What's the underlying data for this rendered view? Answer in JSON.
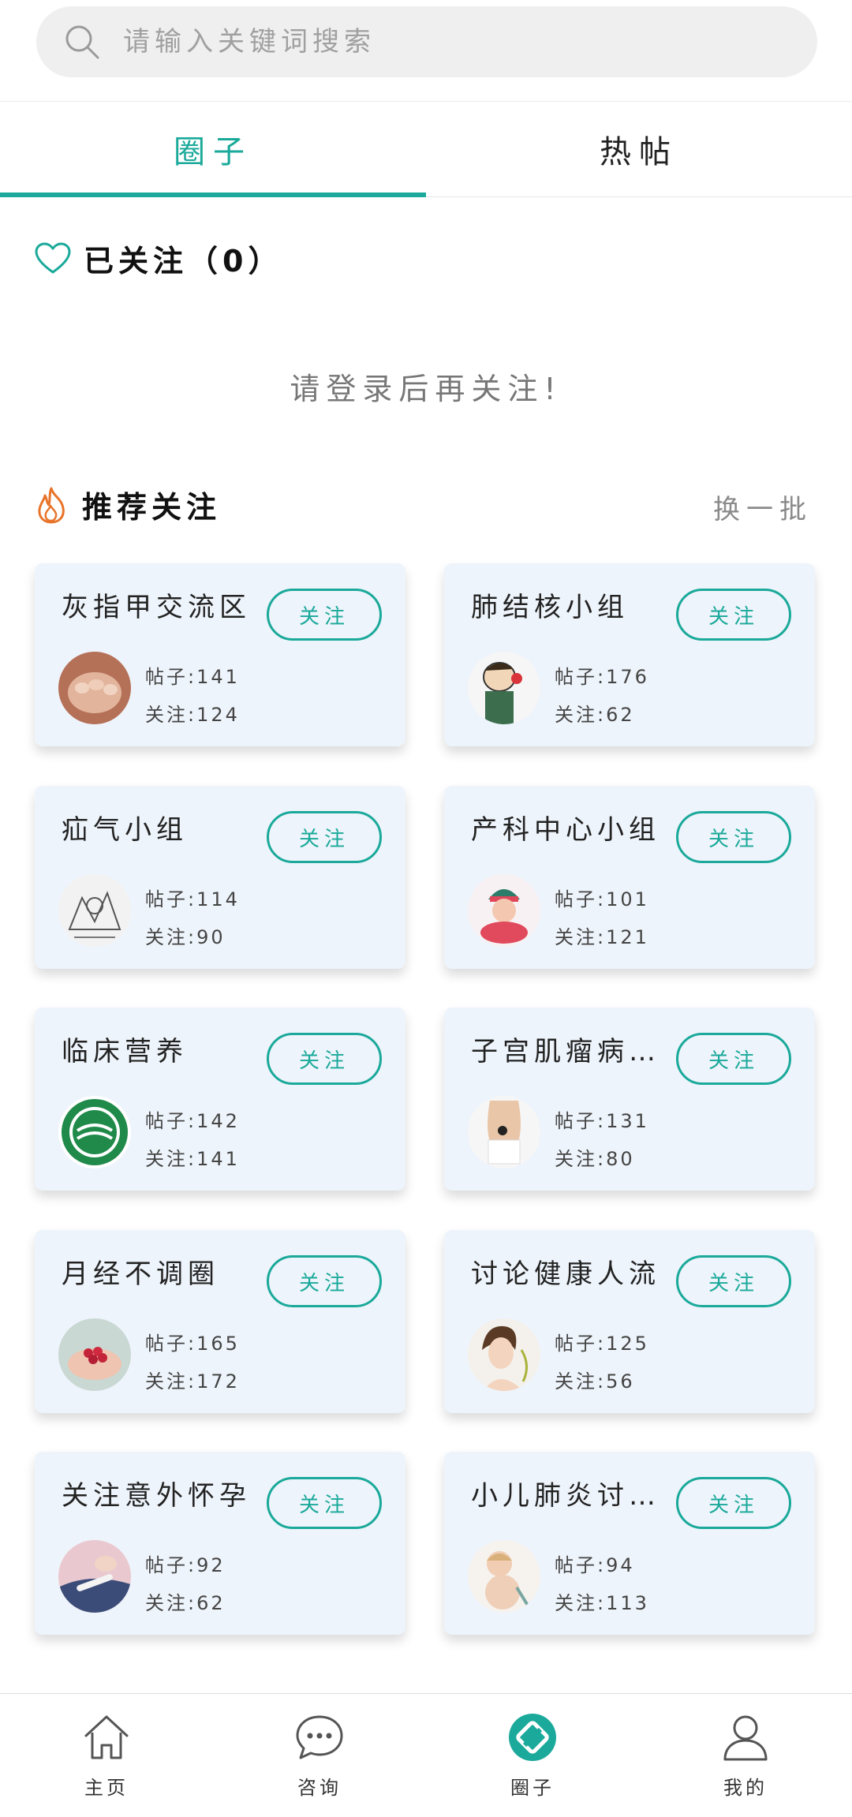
{
  "search": {
    "placeholder": "请输入关键词搜索"
  },
  "tabs": [
    {
      "label": "圈子",
      "active": true
    },
    {
      "label": "热帖",
      "active": false
    }
  ],
  "followed": {
    "title": "已关注（0）",
    "empty_hint": "请登录后再关注!"
  },
  "recommend": {
    "title": "推荐关注",
    "refresh_label": "换一批"
  },
  "groups": [
    {
      "name": "灰指甲交流区",
      "posts": "帖子:141",
      "follows": "关注:124",
      "button": "关注",
      "avatar_icon": "toenail-photo"
    },
    {
      "name": "肺结核小组",
      "posts": "帖子:176",
      "follows": "关注:62",
      "button": "关注",
      "avatar_icon": "cartoon-cough-photo"
    },
    {
      "name": "疝气小组",
      "posts": "帖子:114",
      "follows": "关注:90",
      "button": "关注",
      "avatar_icon": "sketch-illustration"
    },
    {
      "name": "产科中心小组",
      "posts": "帖子:101",
      "follows": "关注:121",
      "button": "关注",
      "avatar_icon": "baby-photo"
    },
    {
      "name": "临床营养",
      "posts": "帖子:142",
      "follows": "关注:141",
      "button": "关注",
      "avatar_icon": "nutrition-logo"
    },
    {
      "name": "子宫肌瘤病…",
      "posts": "帖子:131",
      "follows": "关注:80",
      "button": "关注",
      "avatar_icon": "abdomen-photo"
    },
    {
      "name": "月经不调圈",
      "posts": "帖子:165",
      "follows": "关注:172",
      "button": "关注",
      "avatar_icon": "berries-hands-photo"
    },
    {
      "name": "讨论健康人流",
      "posts": "帖子:125",
      "follows": "关注:56",
      "button": "关注",
      "avatar_icon": "woman-portrait-photo"
    },
    {
      "name": "关注意外怀孕",
      "posts": "帖子:92",
      "follows": "关注:62",
      "button": "关注",
      "avatar_icon": "test-photo"
    },
    {
      "name": "小儿肺炎讨…",
      "posts": "帖子:94",
      "follows": "关注:113",
      "button": "关注",
      "avatar_icon": "child-photo"
    }
  ],
  "bottom_nav": [
    {
      "label": "主页",
      "icon": "home-icon"
    },
    {
      "label": "咨询",
      "icon": "chat-icon"
    },
    {
      "label": "圈子",
      "icon": "circle-icon",
      "active": true
    },
    {
      "label": "我的",
      "icon": "profile-icon"
    }
  ],
  "colors": {
    "accent": "#1aa99a",
    "card_bg": "#eef4fb",
    "fire": "#e8742a"
  }
}
